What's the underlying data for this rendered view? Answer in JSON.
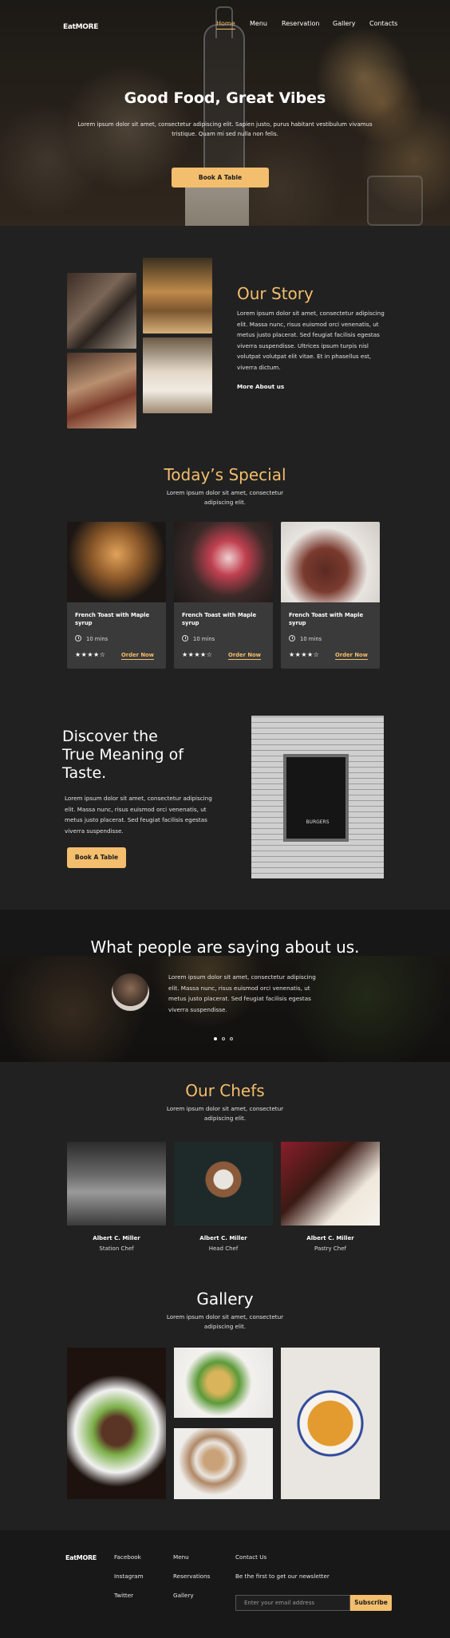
{
  "brand": {
    "logo": "EatMORE"
  },
  "nav": {
    "items": [
      "Home",
      "Menu",
      "Reservation",
      "Gallery",
      "Contacts"
    ],
    "active": "Home"
  },
  "hero": {
    "title": "Good Food, Great Vibes",
    "subtitle": "Lorem ipsum dolor sit amet, consectetur adipiscing elit. Sapien justo, purus habitant vestibulum vivamus tristique. Quam mi sed nulla non felis.",
    "button": "Book A Table"
  },
  "story": {
    "title": "Our Story",
    "text": "Lorem ipsum dolor sit amet, consectetur adipiscing elit. Massa nunc, risus euismod orci venenatis, ut metus justo placerat. Sed feugiat facilisis egestas viverra suspendisse. Ultrices ipsum turpis nisl volutpat volutpat elit vitae. Et in phasellus est, viverra dictum.",
    "link": "More About us"
  },
  "special": {
    "title": "Today’s Special",
    "subtitle": "Lorem ipsum dolor sit amet, consectetur adipiscing elit.",
    "cards": [
      {
        "name": "French Toast with Maple syrup",
        "time": "10 mins",
        "stars": "★★★★☆",
        "order": "Order Now",
        "rating": 4.5
      },
      {
        "name": "French Toast with Maple syrup",
        "time": "10 mins",
        "stars": "★★★★☆",
        "order": "Order Now",
        "rating": 4.5
      },
      {
        "name": "French Toast with Maple syrup",
        "time": "10 mins",
        "stars": "★★★★☆",
        "order": "Order Now",
        "rating": 4.5
      }
    ]
  },
  "discover": {
    "title_line1": "Discover the",
    "title_line2": "True Meaning of",
    "title_line3": "Taste.",
    "text": "Lorem ipsum dolor sit amet, consectetur adipiscing elit. Massa nunc, risus euismod orci venenatis, ut metus justo placerat. Sed feugiat facilisis egestas viverra suspendisse.",
    "button": "Book A Table",
    "sign": "BURGERS"
  },
  "testimonials": {
    "title": "What people are saying about us.",
    "quote": "Lorem ipsum dolor sit amet, consectetur adipiscing elit. Massa nunc, risus euismod orci venenatis, ut metus justo placerat. Sed feugiat facilisis egestas viverra suspendisse.",
    "dots": 3,
    "active_dot": 1
  },
  "chefs": {
    "title": "Our Chefs",
    "subtitle": "Lorem ipsum dolor sit amet, consectetur adipiscing elit.",
    "list": [
      {
        "name": "Albert C. Miller",
        "role": "Station Chef"
      },
      {
        "name": "Albert C. Miller",
        "role": "Head Chef"
      },
      {
        "name": "Albert C. Miller",
        "role": "Pastry Chef"
      }
    ]
  },
  "gallery": {
    "title": "Gallery",
    "subtitle": "Lorem ipsum dolor sit amet, consectetur adipiscing elit."
  },
  "footer": {
    "logo": "EatMORE",
    "social": [
      "Facebook",
      "Instagram",
      "Twitter"
    ],
    "menu": [
      "Menu",
      "Reservations",
      "Gallery"
    ],
    "contact_title": "Contact Us",
    "newsletter_text": "Be the first to get our newsletter",
    "email_placeholder": "Enter your email address",
    "subscribe": "Subscribe"
  },
  "colors": {
    "accent": "#f3be6d",
    "background": "#212121",
    "card": "#3a3a3a"
  }
}
